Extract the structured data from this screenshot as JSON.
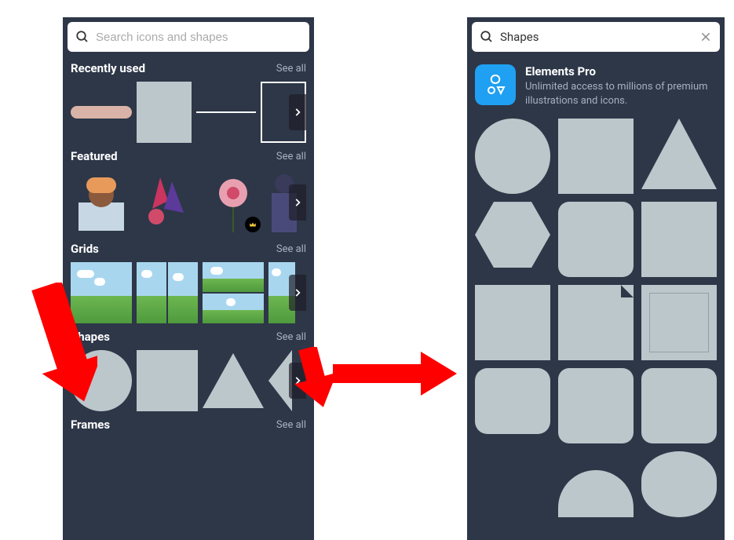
{
  "left_panel": {
    "search": {
      "placeholder": "Search icons and shapes"
    },
    "sections": {
      "recently_used": {
        "title": "Recently used",
        "see_all": "See all"
      },
      "featured": {
        "title": "Featured",
        "see_all": "See all"
      },
      "grids": {
        "title": "Grids",
        "see_all": "See all"
      },
      "shapes": {
        "title": "Shapes",
        "see_all": "See all"
      },
      "frames": {
        "title": "Frames",
        "see_all": "See all"
      }
    }
  },
  "right_panel": {
    "search": {
      "value": "Shapes"
    },
    "promo": {
      "title": "Elements Pro",
      "subtitle": "Unlimited access to millions of premium illustrations and icons."
    }
  },
  "icons": {
    "search": "search",
    "clear": "close",
    "chevron_right": "›",
    "crown": "crown"
  },
  "colors": {
    "panel_bg": "#2d3748",
    "shape_fill": "#bcc7cc",
    "promo_blue": "#1fa0f2",
    "arrow_red": "#ff0000"
  }
}
